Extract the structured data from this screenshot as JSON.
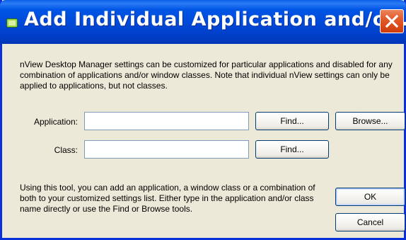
{
  "window": {
    "title": "Add Individual Application and/o...",
    "icon": "application-icon"
  },
  "description": "nView Desktop Manager settings can be customized for particular applications and disabled for any combination of applications and/or window classes. Note that individual nView settings can only be applied to applications, but not classes.",
  "form": {
    "application_label": "Application:",
    "application_value": "",
    "class_label": "Class:",
    "class_value": "",
    "find_label": "Find...",
    "browse_label": "Browse..."
  },
  "help_text": "Using this tool, you can add an application, a window class or a combination of both to your customized settings list. Either type in the application and/or class name directly or use the Find or Browse tools.",
  "buttons": {
    "ok": "OK",
    "cancel": "Cancel"
  },
  "colors": {
    "titlebar": "#0055e5",
    "close": "#e35a2a",
    "dialog_bg": "#ece9d8"
  }
}
